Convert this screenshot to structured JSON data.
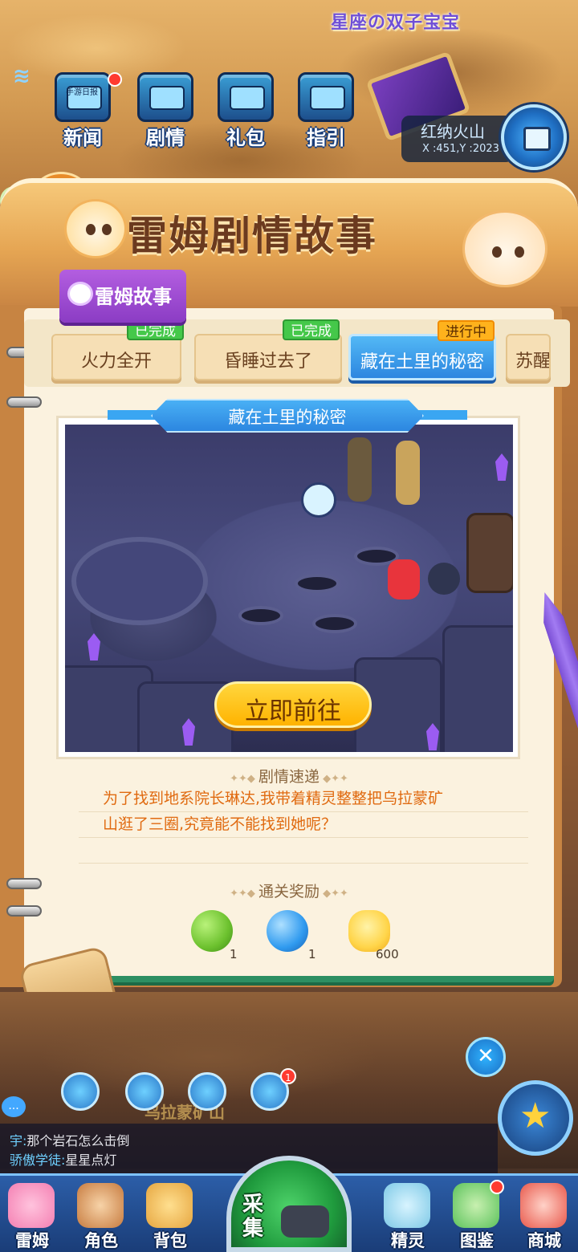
{
  "game": {
    "logo": "星座の双子宝宝"
  },
  "top_menu": [
    {
      "label": "新闻",
      "icon": "newspaper-icon",
      "has_dot": true,
      "screen_text": "手游日报"
    },
    {
      "label": "剧情",
      "icon": "story-icon",
      "has_dot": false
    },
    {
      "label": "礼包",
      "icon": "gift-icon",
      "has_dot": false
    },
    {
      "label": "指引",
      "icon": "guide-icon",
      "has_dot": false
    }
  ],
  "location": {
    "name": "红纳火山",
    "coords": "X :451,Y :2023",
    "icon": "map-icon"
  },
  "panel": {
    "title": "雷姆剧情故事"
  },
  "chapter": {
    "label": "雷姆故事",
    "icon": "pet-head-icon"
  },
  "story_tabs": [
    {
      "label": "火力全开",
      "status": "已完成",
      "state": "done"
    },
    {
      "label": "昏睡过去了",
      "status": "已完成",
      "state": "done"
    },
    {
      "label": "藏在土里的秘密",
      "status": "进行中",
      "state": "progress"
    },
    {
      "label": "苏醒",
      "status": "",
      "state": "locked"
    }
  ],
  "scene": {
    "title": "藏在土里的秘密",
    "go_label": "立即前往"
  },
  "synopsis": {
    "heading": "剧情速递",
    "lines": [
      "为了找到地系院长琳达,我带着精灵整整把乌拉蒙矿",
      "山逛了三圈,究竟能不能找到她呢？"
    ]
  },
  "rewards": {
    "heading": "通关奖励",
    "items": [
      {
        "icon": "green-fruit-icon",
        "qty": "1",
        "color": "#6cc12e"
      },
      {
        "icon": "blue-fruit-icon",
        "qty": "1",
        "color": "#2f9aef"
      },
      {
        "icon": "cat-coin-icon",
        "qty": "600",
        "color": "#ffd54a"
      }
    ]
  },
  "area_sign": "乌拉蒙矿山",
  "mini_icons": [
    {
      "icon": "compass-icon",
      "badge": ""
    },
    {
      "icon": "star-badge-icon",
      "badge": ""
    },
    {
      "icon": "panda-icon",
      "badge": ""
    },
    {
      "icon": "bell-icon",
      "badge": "1"
    }
  ],
  "chat": {
    "bubble": "...",
    "messages": [
      {
        "speaker": "宇:",
        "text": "那个岩石怎么击倒"
      },
      {
        "speaker": "骄傲学徒:",
        "text": "星星点灯"
      }
    ]
  },
  "bottom_nav": [
    {
      "label": "雷姆",
      "icon": "leimu-icon",
      "color": "#f47fb2",
      "has_dot": false
    },
    {
      "label": "角色",
      "icon": "character-icon",
      "color": "#c77b3f",
      "has_dot": false
    },
    {
      "label": "背包",
      "icon": "backpack-icon",
      "color": "#e6a640",
      "has_dot": false
    },
    {
      "label": "精灵",
      "icon": "spirit-icon",
      "color": "#7ec9e6",
      "has_dot": false
    },
    {
      "label": "图鉴",
      "icon": "handbook-icon",
      "color": "#5bc25b",
      "has_dot": true
    },
    {
      "label": "商城",
      "icon": "shop-icon",
      "color": "#e8574a",
      "has_dot": false
    }
  ],
  "collect": {
    "label": "采集",
    "icon": "ore-icon"
  },
  "colors": {
    "active_tab": "#2c86e0",
    "done_badge": "#45c84a",
    "progress_badge": "#ffb21c",
    "go_button": "#ffc61e",
    "synopsis_text": "#e06a10"
  }
}
